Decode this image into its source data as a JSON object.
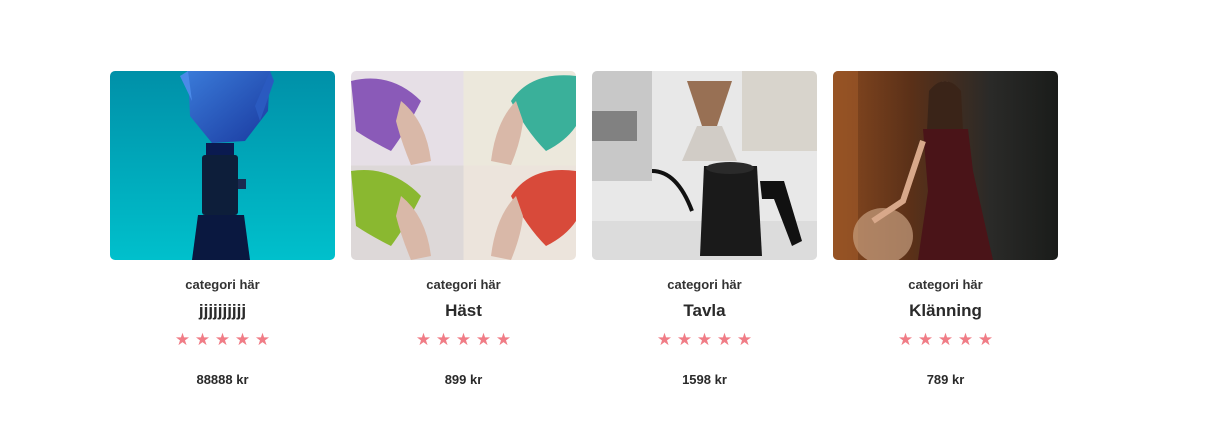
{
  "products": [
    {
      "category": "categori här",
      "title": "jjjjjjjjjj",
      "rating": 5,
      "star_glyph": "★",
      "price": "88888 kr",
      "image": "robot-hand-image"
    },
    {
      "category": "categori här",
      "title": "Häst",
      "rating": 5,
      "star_glyph": "★",
      "price": "899 kr",
      "image": "colorful-hair-collage-image"
    },
    {
      "category": "categori här",
      "title": "Tavla",
      "rating": 5,
      "star_glyph": "★",
      "price": "1598 kr",
      "image": "coffee-kettle-image"
    },
    {
      "category": "categori här",
      "title": "Klänning",
      "rating": 5,
      "star_glyph": "★",
      "price": "789 kr",
      "image": "woman-dress-image"
    }
  ],
  "colors": {
    "star": "#f07c86",
    "text": "#2a2a2a"
  }
}
